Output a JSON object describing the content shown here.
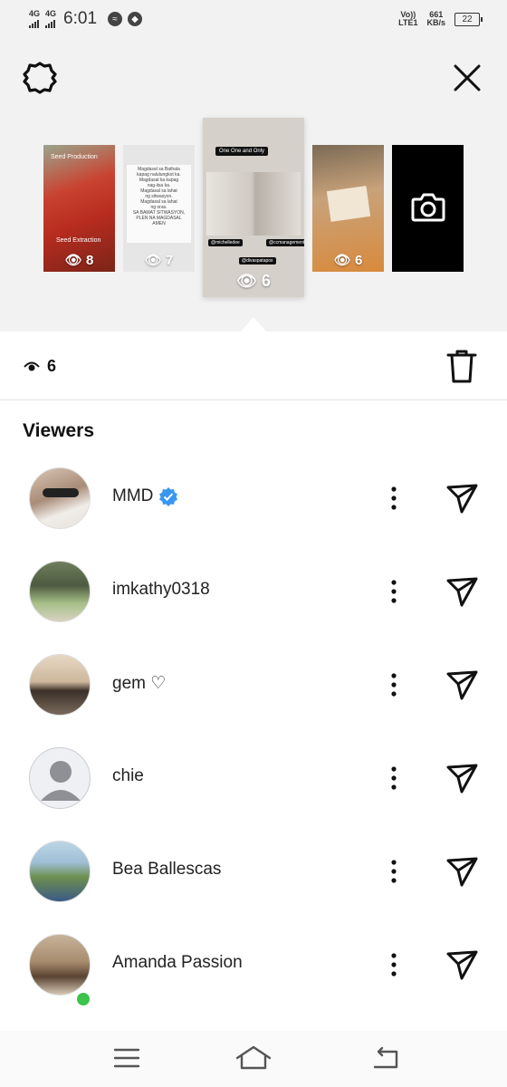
{
  "status_bar": {
    "network1": "4G",
    "network2": "4G",
    "time": "6:01",
    "volte_line1": "Vo))",
    "volte_line2": "LTE1",
    "speed_value": "661",
    "speed_unit": "KB/s",
    "battery": "22"
  },
  "header": {
    "settings_icon": "gear-icon",
    "close_icon": "close-icon"
  },
  "stories": [
    {
      "view_count": "8",
      "top_caption": "Seed Production",
      "bottom_caption": "Seed Extraction"
    },
    {
      "view_count": "7",
      "lines": [
        "Magdasal sa Bathala",
        "kapag nalulungkot ka.",
        "Magdasal ka kapag",
        "nag-iisa ka.",
        "Magdasal sa lahat",
        "ng sitwasyon.",
        "Magdasal sa lahat",
        "ng oras.",
        "SA BAWAT SITWASYON,",
        "PLEN NA MAGDASAL",
        "AMEN"
      ]
    },
    {
      "view_count": "6",
      "banner": "One One and Only",
      "tag_left": "@michelledee",
      "tag_right": "@ccmanagement",
      "tag_bottom": "@divaspatapox"
    },
    {
      "view_count": "6"
    },
    {
      "icon": "camera-icon"
    }
  ],
  "view_summary": {
    "count": "6",
    "delete_icon": "trash-icon"
  },
  "viewers_title": "Viewers",
  "viewers": [
    {
      "name": "MMD",
      "verified": true,
      "online": false
    },
    {
      "name": "imkathy0318",
      "verified": false,
      "online": false
    },
    {
      "name": "gem ♡",
      "verified": false,
      "online": false
    },
    {
      "name": "chie",
      "verified": false,
      "online": false
    },
    {
      "name": "Bea Ballescas",
      "verified": false,
      "online": false
    },
    {
      "name": "Amanda Passion",
      "verified": false,
      "online": true
    }
  ],
  "colors": {
    "verified": "#3897f0",
    "online": "#3bc34b",
    "tray_background": "#f2f2f2"
  },
  "navbar": {
    "menu_icon": "menu-icon",
    "home_icon": "home-icon",
    "back_icon": "back-icon"
  }
}
